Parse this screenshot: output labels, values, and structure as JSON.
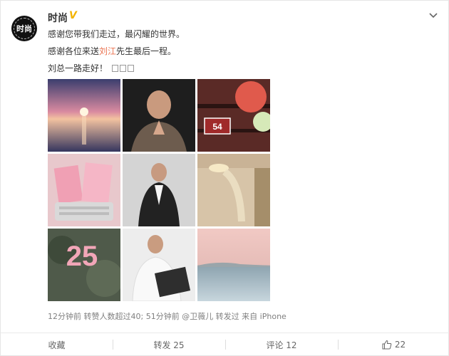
{
  "post": {
    "avatar_text": "时尚",
    "username": "时尚",
    "verified_badge": "V",
    "line1": "感谢您带我们走过，最闪耀的世界。",
    "line2_prefix": "感谢各位来送",
    "line2_link": "刘江",
    "line2_suffix": "先生最后一程。",
    "line3": "刘总一路走好！",
    "meta": "12分钟前 转赞人数超过40; 51分钟前 @卫薇儿 转发过 来自 iPhone"
  },
  "photos": [
    {
      "name": "photo-sunset-sea"
    },
    {
      "name": "photo-man-praying"
    },
    {
      "name": "photo-door-54",
      "label": "54"
    },
    {
      "name": "photo-magazine-typewriter"
    },
    {
      "name": "photo-man-suit"
    },
    {
      "name": "photo-chandelier"
    },
    {
      "name": "photo-balloon-25",
      "label": "25"
    },
    {
      "name": "photo-man-reading"
    },
    {
      "name": "photo-calm-sea"
    }
  ],
  "actions": {
    "collect": "收藏",
    "repost": "转发 25",
    "comment": "评论 12",
    "like": "22"
  },
  "icons": [
    "chevron-down-icon",
    "thumbs-up-icon",
    "verified-icon"
  ]
}
